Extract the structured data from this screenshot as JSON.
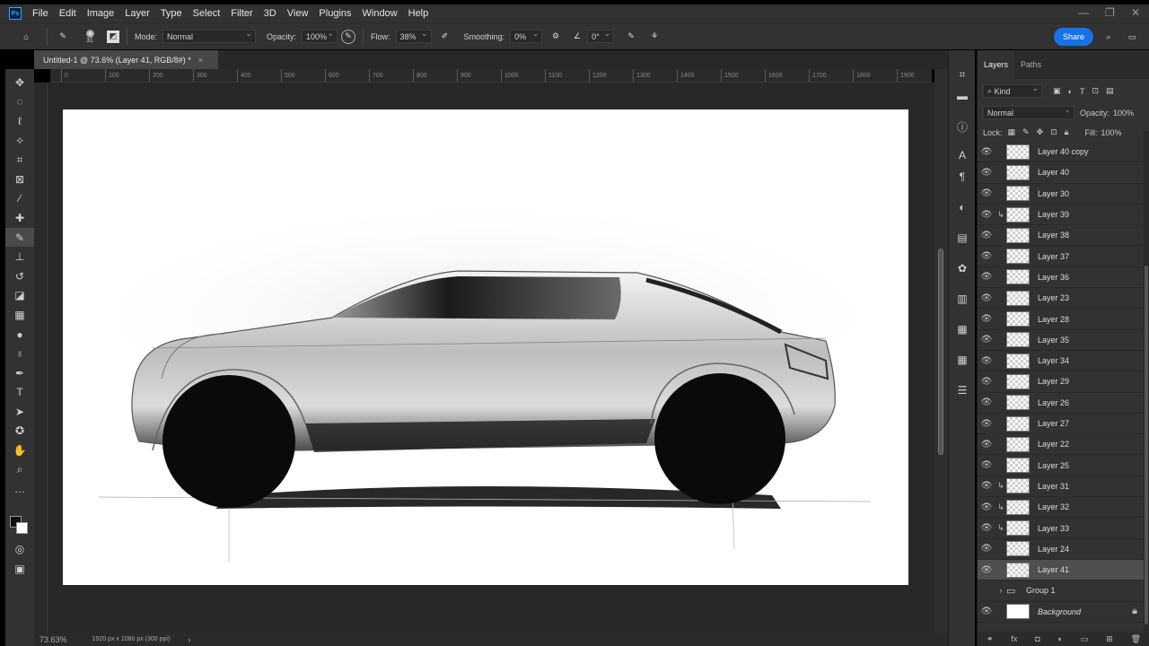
{
  "app": {
    "logo": "Ps"
  },
  "menu": [
    "File",
    "Edit",
    "Image",
    "Layer",
    "Type",
    "Select",
    "Filter",
    "3D",
    "View",
    "Plugins",
    "Window",
    "Help"
  ],
  "window_controls": [
    "—",
    "❐",
    "✕"
  ],
  "options": {
    "brush_size": "31",
    "mode_label": "Mode:",
    "mode_value": "Normal",
    "opacity_label": "Opacity:",
    "opacity_value": "100%",
    "flow_label": "Flow:",
    "flow_value": "38%",
    "smoothing_label": "Smoothing:",
    "smoothing_value": "0%",
    "angle_value": "0°",
    "share_label": "Share"
  },
  "document_tab": {
    "title": "Untitled-1 @ 73.6% (Layer 41, RGB/8#) *",
    "close": "×"
  },
  "ruler_ticks": [
    "0",
    "100",
    "200",
    "300",
    "400",
    "500",
    "600",
    "700",
    "800",
    "900",
    "1000",
    "1100",
    "1200",
    "1300",
    "1400",
    "1500",
    "1600",
    "1700",
    "1800",
    "1900"
  ],
  "status": {
    "zoom": "73.63%",
    "doc_size": "1920 px x 1080 px (300 ppi)"
  },
  "layers_panel": {
    "tabs": [
      "Layers",
      "Paths"
    ],
    "filter_kind": "Kind",
    "blend_mode": "Normal",
    "opacity_label": "Opacity:",
    "opacity_value": "100%",
    "lock_label": "Lock:",
    "fill_label": "Fill:",
    "fill_value": "100%",
    "layers": [
      {
        "name": "Layer 40 copy",
        "clipped": false,
        "selected": false
      },
      {
        "name": "Layer 40",
        "clipped": false,
        "selected": false
      },
      {
        "name": "Layer 30",
        "clipped": false,
        "selected": false
      },
      {
        "name": "Layer 39",
        "clipped": true,
        "selected": false
      },
      {
        "name": "Layer 38",
        "clipped": false,
        "selected": false
      },
      {
        "name": "Layer 37",
        "clipped": false,
        "selected": false
      },
      {
        "name": "Layer 36",
        "clipped": false,
        "selected": false
      },
      {
        "name": "Layer 23",
        "clipped": false,
        "selected": false
      },
      {
        "name": "Layer 28",
        "clipped": false,
        "selected": false
      },
      {
        "name": "Layer 35",
        "clipped": false,
        "selected": false
      },
      {
        "name": "Layer 34",
        "clipped": false,
        "selected": false
      },
      {
        "name": "Layer 29",
        "clipped": false,
        "selected": false
      },
      {
        "name": "Layer 26",
        "clipped": false,
        "selected": false
      },
      {
        "name": "Layer 27",
        "clipped": false,
        "selected": false
      },
      {
        "name": "Layer 22",
        "clipped": false,
        "selected": false
      },
      {
        "name": "Layer 25",
        "clipped": false,
        "selected": false
      },
      {
        "name": "Layer 31",
        "clipped": true,
        "selected": false
      },
      {
        "name": "Layer 32",
        "clipped": true,
        "selected": false
      },
      {
        "name": "Layer 33",
        "clipped": true,
        "selected": false
      },
      {
        "name": "Layer 24",
        "clipped": false,
        "selected": false
      },
      {
        "name": "Layer 41",
        "clipped": false,
        "selected": true
      }
    ],
    "group": "Group 1",
    "background": "Background"
  },
  "colors": {
    "accent": "#1473e6",
    "panel": "#323232",
    "canvas_bg": "#282828"
  }
}
